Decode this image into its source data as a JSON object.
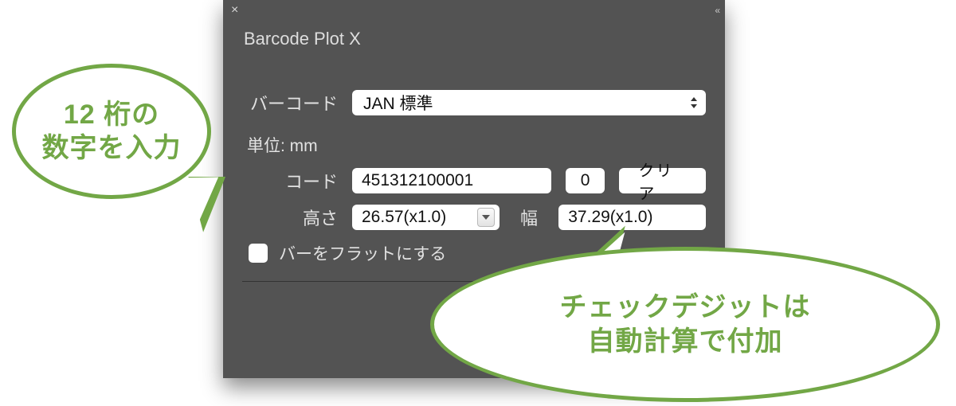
{
  "panel": {
    "tab_label": "Barcode Plot X",
    "close_glyph": "×",
    "collapse_glyph": "«"
  },
  "form": {
    "barcode_label": "バーコード",
    "barcode_value": "JAN 標準",
    "unit_label": "単位: mm",
    "code_label": "コード",
    "code_value": "451312100001",
    "check_digit": "0",
    "clear_label": "クリア",
    "height_label": "高さ",
    "height_value": "26.57(x1.0)",
    "width_label": "幅",
    "width_value": "37.29(x1.0)",
    "flat_label": "バーをフラットにする"
  },
  "callouts": {
    "c1": "12 桁の\n数字を入力",
    "c2": "チェックデジットは\n自動計算で付加"
  },
  "colors": {
    "accent": "#72a746",
    "panel_bg": "#535353"
  }
}
